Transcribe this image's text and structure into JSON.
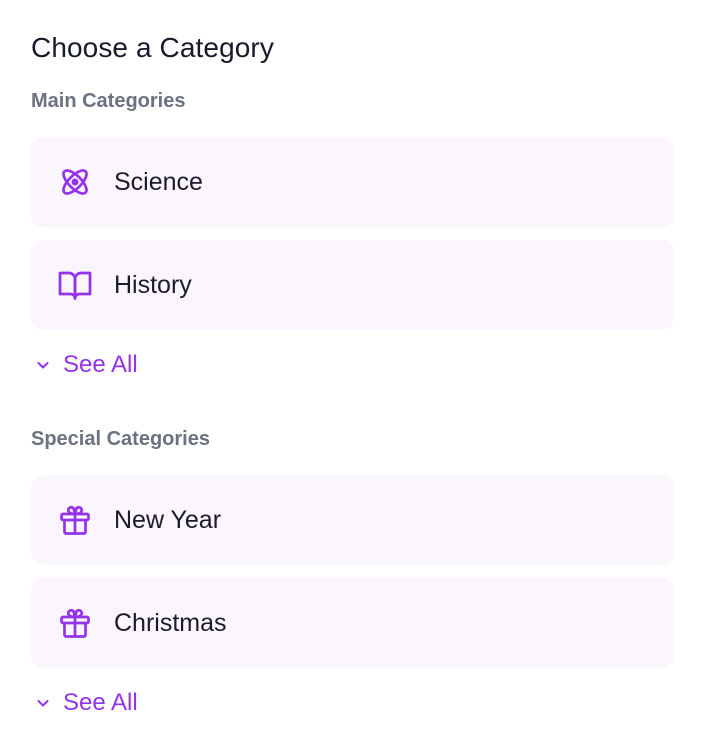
{
  "title": "Choose a Category",
  "accent_color": "#9333ea",
  "card_background": "#fbf5fe",
  "sections": {
    "main": {
      "heading": "Main Categories",
      "items": [
        {
          "label": "Science",
          "icon": "atom-icon"
        },
        {
          "label": "History",
          "icon": "book-open-icon"
        }
      ],
      "see_all_label": "See All"
    },
    "special": {
      "heading": "Special Categories",
      "items": [
        {
          "label": "New Year",
          "icon": "gift-icon"
        },
        {
          "label": "Christmas",
          "icon": "gift-icon"
        }
      ],
      "see_all_label": "See All"
    }
  }
}
